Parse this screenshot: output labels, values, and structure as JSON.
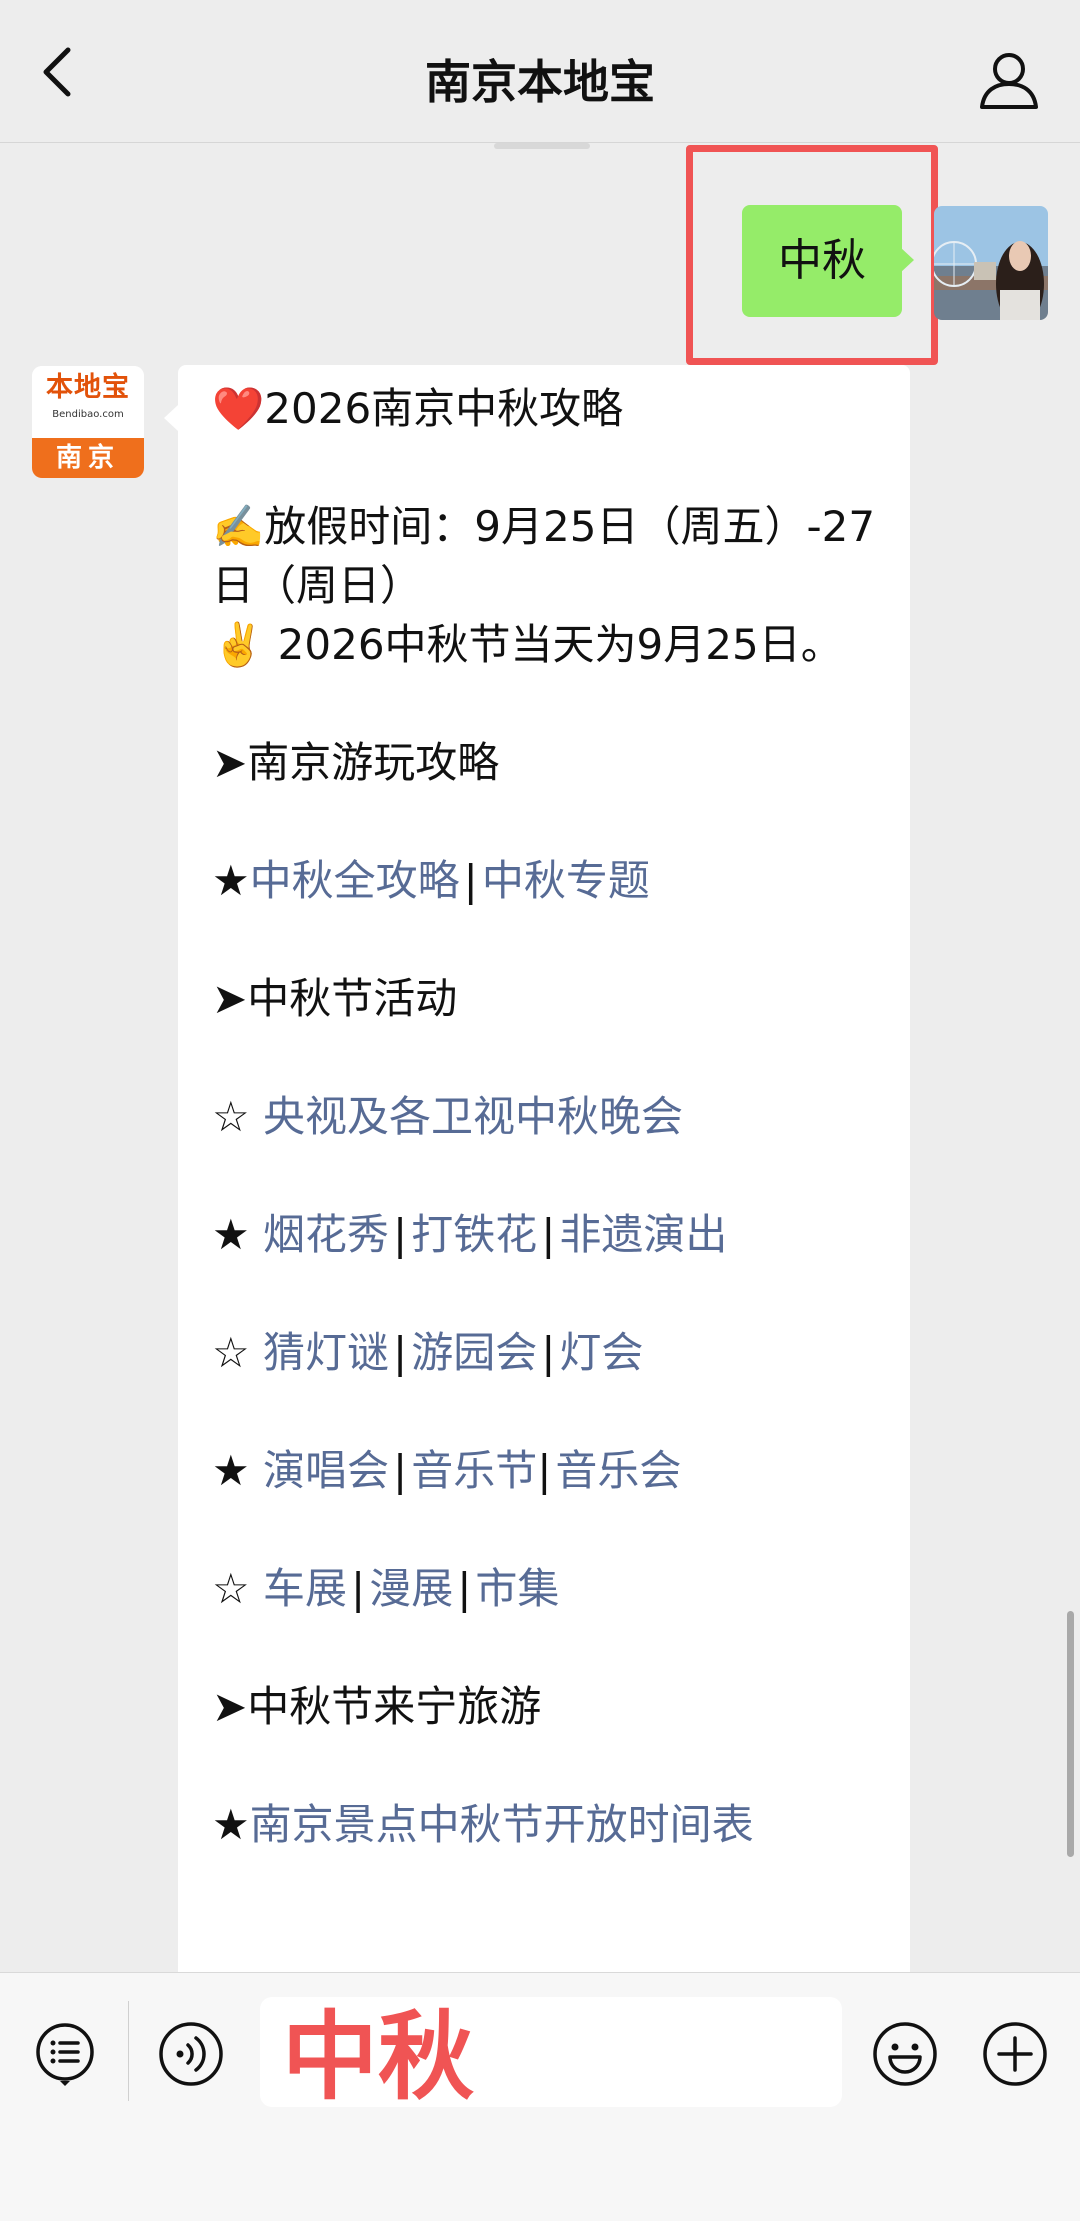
{
  "header": {
    "title": "南京本地宝"
  },
  "conversation": {
    "outgoing": {
      "text": "中秋"
    },
    "incoming": {
      "sender_logo": {
        "name": "本地宝",
        "domain": "Bendibao.com",
        "city": "南京"
      },
      "lines": [
        {
          "icon": "❤️",
          "text": "2026南京中秋攻略"
        },
        {
          "icon": "✍️",
          "text": "放假时间：9月25日（周五）-27日（周日）"
        },
        {
          "icon": "✌️",
          "text": "2026中秋节当天为9月25日。"
        },
        {
          "icon": "➤",
          "text": "南京游玩攻略"
        },
        {
          "star": "★",
          "links": [
            "中秋全攻略",
            "中秋专题"
          ]
        },
        {
          "icon": "➤",
          "text": "中秋节活动"
        },
        {
          "star": "☆",
          "links": [
            "央视及各卫视中秋晚会"
          ]
        },
        {
          "star": "★",
          "links": [
            "烟花秀",
            "打铁花",
            "非遗演出"
          ]
        },
        {
          "star": "☆",
          "links": [
            "猜灯谜",
            "游园会",
            "灯会"
          ]
        },
        {
          "star": "★",
          "links": [
            "演唱会",
            "音乐节",
            "音乐会"
          ]
        },
        {
          "star": "☆",
          "links": [
            "车展",
            "漫展",
            "市集"
          ]
        },
        {
          "icon": "➤",
          "text": "中秋节来宁旅游"
        },
        {
          "star": "★",
          "links": [
            "南京景点中秋节开放时间表"
          ]
        }
      ]
    }
  },
  "input_bar": {
    "input_value": "中秋"
  },
  "icons": {
    "back": "chevron-left-icon",
    "profile": "person-icon",
    "menu": "list-menu-icon",
    "voice": "voice-icon",
    "emoji": "emoji-icon",
    "add": "plus-icon"
  },
  "colors": {
    "outgoing_bubble": "#95ec69",
    "link": "#576b95",
    "highlight": "#f05454",
    "brand_orange": "#ef6f1c"
  }
}
